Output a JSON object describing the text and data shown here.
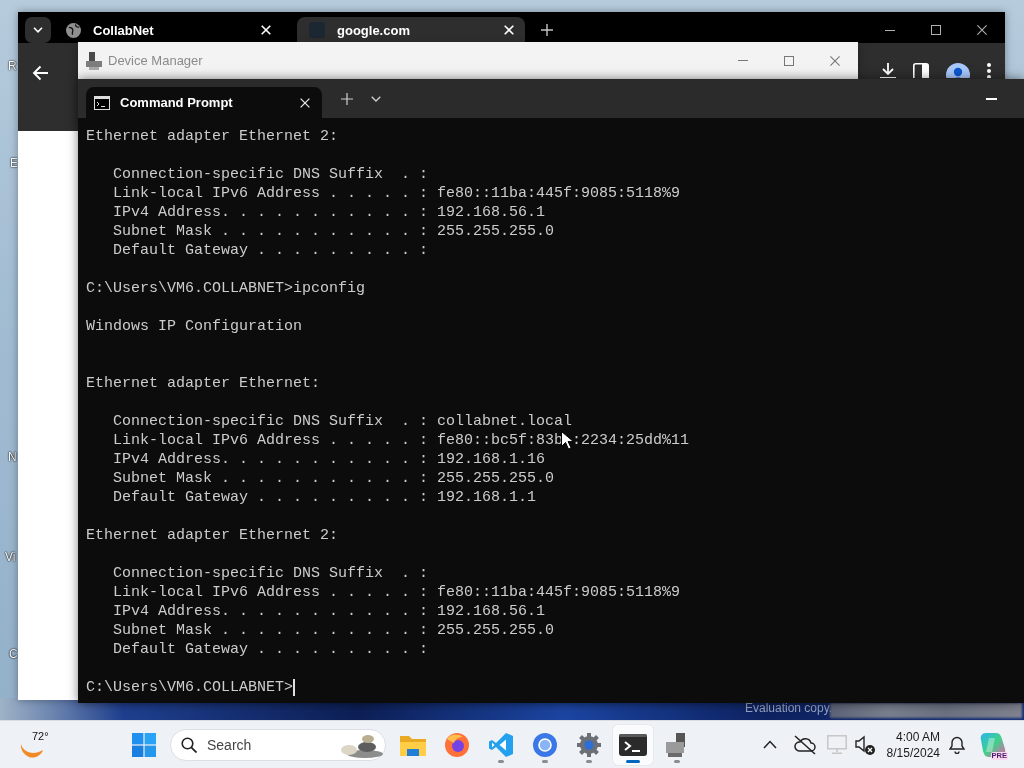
{
  "desktop": {
    "icon_labels": [
      "R",
      "E",
      "N",
      "Vi",
      "C"
    ],
    "watermark": "Evaluation copy."
  },
  "browser": {
    "tabs": [
      {
        "kind": "globe",
        "title": "CollabNet",
        "selected": false
      },
      {
        "kind": "square",
        "title": "google.com",
        "selected": true
      }
    ]
  },
  "device_manager": {
    "title": "Device Manager"
  },
  "terminal": {
    "tabs": [
      {
        "title": "Command Prompt",
        "selected": true
      }
    ],
    "lines": [
      {
        "kind": "text",
        "text": "Ethernet adapter Ethernet 2:",
        "children": [
          {
            "kind": "text",
            "text": "Connection-specific DNS Suffix  . :"
          },
          {
            "kind": "text",
            "text": "Link-local IPv6 Address . . . . . : fe80::11ba:445f:9085:5118%9"
          },
          {
            "kind": "text",
            "text": "IPv4 Address. . . . . . . . . . . : 192.168.56.1"
          },
          {
            "kind": "text",
            "text": "Subnet Mask . . . . . . . . . . . : 255.255.255.0"
          },
          {
            "kind": "text",
            "text": "Default Gateway . . . . . . . . . :"
          }
        ]
      },
      {
        "kind": "blank"
      },
      {
        "kind": "text",
        "text": "C:\\Users\\VM6.COLLABNET>ipconfig"
      },
      {
        "kind": "blank"
      },
      {
        "kind": "text",
        "text": "Windows IP Configuration"
      },
      {
        "kind": "blank"
      },
      {
        "kind": "blank"
      },
      {
        "kind": "text",
        "text": "Ethernet adapter Ethernet:",
        "children": [
          {
            "kind": "text",
            "text": "Connection-specific DNS Suffix  . : collabnet.local"
          },
          {
            "kind": "covered",
            "text": "Link-local IPv6 Address . . . . . : fe80::bc5f:83b",
            "text_after": ":2234:25dd%11"
          },
          {
            "kind": "text",
            "text": "IPv4 Address. . . . . . . . . . . : 192.168.1.16"
          },
          {
            "kind": "text",
            "text": "Subnet Mask . . . . . . . . . . . : 255.255.255.0"
          },
          {
            "kind": "text",
            "text": "Default Gateway . . . . . . . . . : 192.168.1.1"
          }
        ]
      },
      {
        "kind": "blank"
      },
      {
        "kind": "text",
        "text": "Ethernet adapter Ethernet 2:",
        "children": [
          {
            "kind": "text",
            "text": "Connection-specific DNS Suffix  . :"
          },
          {
            "kind": "text",
            "text": "Link-local IPv6 Address . . . . . : fe80::11ba:445f:9085:5118%9"
          },
          {
            "kind": "text",
            "text": "IPv4 Address. . . . . . . . . . . : 192.168.56.1"
          },
          {
            "kind": "text",
            "text": "Subnet Mask . . . . . . . . . . . : 255.255.255.0"
          },
          {
            "kind": "text",
            "text": "Default Gateway . . . . . . . . . :"
          }
        ]
      },
      {
        "kind": "blank"
      },
      {
        "kind": "prompt",
        "text": "C:\\Users\\VM6.COLLABNET>"
      }
    ]
  },
  "taskbar": {
    "weather": "72°",
    "search_label": "Search",
    "apps": [
      {
        "kind": "folder",
        "running": false,
        "selected": false
      },
      {
        "kind": "foxbrowser",
        "running": false,
        "selected": false
      },
      {
        "kind": "editor",
        "running": true,
        "selected": false
      },
      {
        "kind": "browser",
        "running": true,
        "selected": false
      },
      {
        "kind": "gear",
        "running": true,
        "selected": false
      },
      {
        "kind": "terminal",
        "running": true,
        "selected": true
      },
      {
        "kind": "computer",
        "running": true,
        "selected": false
      }
    ],
    "clock": {
      "time": "4:00 AM",
      "date": "8/15/2024"
    },
    "copilot_badge": "PRE"
  }
}
